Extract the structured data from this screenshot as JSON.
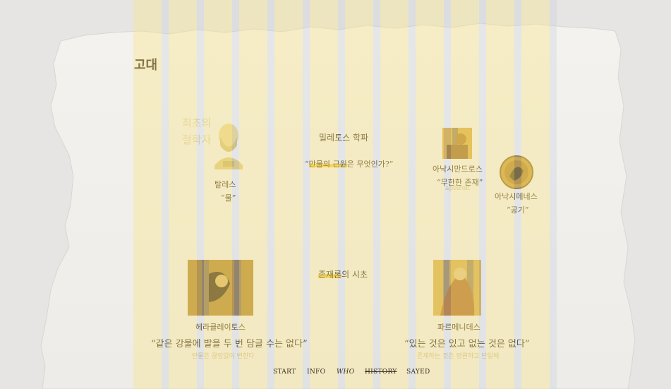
{
  "page": {
    "title": "고대"
  },
  "ghost": {
    "line1": "최초의",
    "line2": "철학자"
  },
  "thales": {
    "name": "탈레스",
    "quote": "“물”"
  },
  "milesian": {
    "heading": "밀레토스 학파",
    "question_hl": "만물의 근원",
    "question_rest": "은 무엇인가?”",
    "question_open": "“"
  },
  "anaximander": {
    "name": "아낙시만드로스",
    "quote": "“무한한 존재”",
    "sub": "apeiron"
  },
  "anaximenes": {
    "name": "아낙시메네스",
    "quote": "“공기”"
  },
  "ontology": {
    "heading_hl": "존재론",
    "heading_rest": "의 시초"
  },
  "heraclitus": {
    "name": "헤라클레이토스",
    "quote": "“같은 강물에 발을 두 번 담글 수는 없다”",
    "sub": "만물은 끊임없이 변한다"
  },
  "parmenides": {
    "name": "파르메니데스",
    "quote": "“있는 것은 있고 없는 것은 없다”",
    "sub": "존재하는 것은 영원하고 단일해"
  },
  "nav": {
    "start": "START",
    "info": "INFO",
    "who": "WHO",
    "history": "HISTORY",
    "sayed": "SAYED"
  },
  "colors": {
    "accent": "#f5c414",
    "stripe": "#f7e58c",
    "text": "#3a2d0e"
  },
  "icons": [
    "thales-bust-icon",
    "anaximander-portrait-icon",
    "anaximenes-medallion-icon",
    "heraclitus-painting-icon",
    "parmenides-painting-icon"
  ]
}
